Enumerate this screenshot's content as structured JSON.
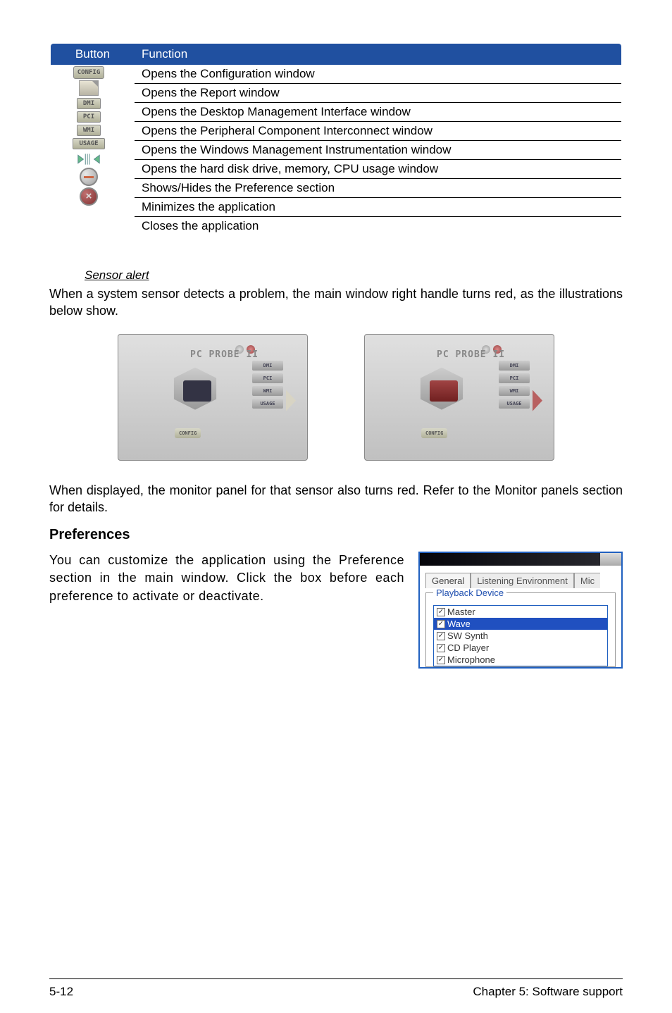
{
  "func_table": {
    "headers": {
      "button": "Button",
      "function": "Function"
    },
    "icons": {
      "config": "CONFIG",
      "dmi": "DMI",
      "pci": "PCI",
      "wmi": "WMI",
      "usage": "USAGE"
    },
    "rows": [
      "Opens the Configuration window",
      "Opens the Report window",
      "Opens the Desktop Management Interface window",
      "Opens the Peripheral Component Interconnect window",
      "Opens the Windows Management Instrumentation window",
      "Opens the hard disk drive, memory, CPU usage window",
      "Shows/Hides the Preference section",
      "Minimizes the application",
      "Closes the application"
    ]
  },
  "sensor": {
    "heading": "Sensor alert",
    "para1": "When a system sensor detects a problem, the main window right handle turns red, as the illustrations below show.",
    "probe_title": "PC PROBE II",
    "labels": {
      "dmi": "DMI",
      "pci": "PCI",
      "wmi": "WMI",
      "usage": "USAGE",
      "config": "CONFIG"
    },
    "para2": "When displayed, the monitor panel for that sensor also turns red. Refer to the Monitor panels section for details."
  },
  "prefs": {
    "heading": "Preferences",
    "text": "You can customize the application using the Preference section in the main window. Click the box before each preference to activate or deactivate.",
    "tabs": {
      "general": "General",
      "listening": "Listening Environment",
      "mic": "Mic"
    },
    "legend": "Playback Device",
    "items": {
      "master": "Master",
      "wave": "Wave",
      "swsynth": "SW Synth",
      "cdplayer": "CD Player",
      "microphone": "Microphone"
    }
  },
  "footer": {
    "left": "5-12",
    "right": "Chapter 5: Software support"
  }
}
